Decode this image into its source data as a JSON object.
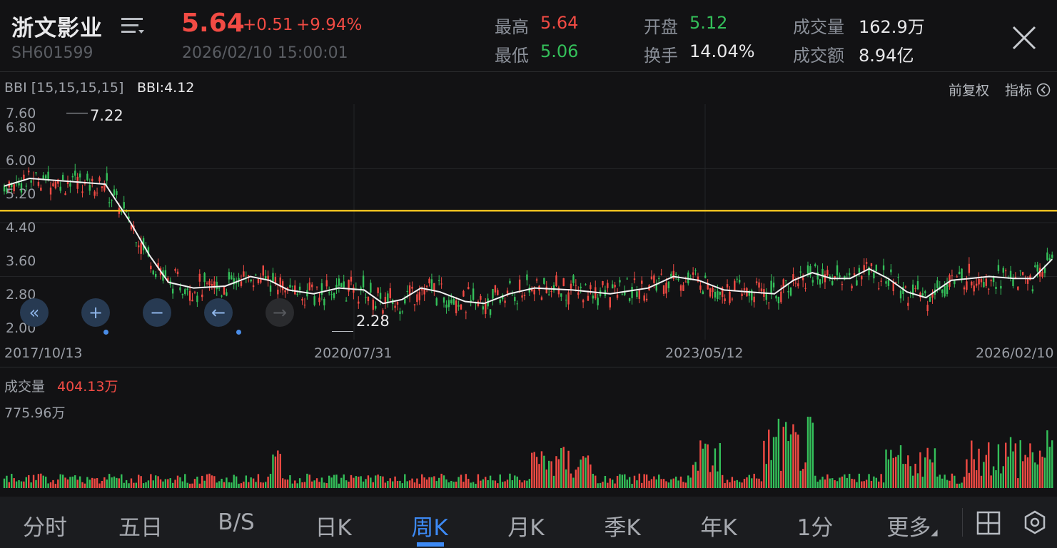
{
  "header": {
    "stock_name": "浙文影业",
    "stock_code": "SH601599",
    "price": "5.64",
    "change": "+0.51",
    "change_pct": "+9.94%",
    "datetime": "2026/02/10 15:00:01",
    "stats": {
      "high_label": "最高",
      "high": "5.64",
      "low_label": "最低",
      "low": "5.06",
      "open_label": "开盘",
      "open": "5.12",
      "turnover_label": "换手",
      "turnover": "14.04%",
      "volume_label": "成交量",
      "volume": "162.9万",
      "amount_label": "成交额",
      "amount": "8.94亿"
    }
  },
  "indicator_bar": {
    "name": "BBI [15,15,15,15]",
    "value": "BBI:4.12",
    "adjust": "前复权",
    "indicator": "指标"
  },
  "chart_data": {
    "type": "candlestick",
    "y_ticks": [
      "7.60",
      "6.80",
      "6.00",
      "5.20",
      "4.40",
      "3.60",
      "2.80",
      "2.00"
    ],
    "ylim": [
      2.0,
      7.6
    ],
    "x_ticks": [
      "2017/10/13",
      "2020/07/31",
      "2023/05/12",
      "2026/02/10"
    ],
    "max_label": "7.22",
    "min_label": "2.28",
    "reference_line": 5.11,
    "bbi_points": [
      [
        2017.8,
        5.75
      ],
      [
        2018.0,
        5.95
      ],
      [
        2018.4,
        5.85
      ],
      [
        2018.6,
        5.8
      ],
      [
        2018.8,
        4.8
      ],
      [
        2018.95,
        3.95
      ],
      [
        2019.1,
        3.25
      ],
      [
        2019.3,
        3.1
      ],
      [
        2019.55,
        3.15
      ],
      [
        2019.75,
        3.4
      ],
      [
        2019.9,
        3.3
      ],
      [
        2020.05,
        3.05
      ],
      [
        2020.25,
        2.95
      ],
      [
        2020.45,
        3.1
      ],
      [
        2020.65,
        3.05
      ],
      [
        2020.8,
        2.7
      ],
      [
        2020.95,
        2.8
      ],
      [
        2021.1,
        3.1
      ],
      [
        2021.25,
        3.0
      ],
      [
        2021.45,
        2.75
      ],
      [
        2021.6,
        2.7
      ],
      [
        2021.8,
        2.95
      ],
      [
        2022.0,
        3.1
      ],
      [
        2022.3,
        3.05
      ],
      [
        2022.6,
        2.95
      ],
      [
        2022.9,
        3.1
      ],
      [
        2023.1,
        3.4
      ],
      [
        2023.3,
        3.3
      ],
      [
        2023.5,
        3.05
      ],
      [
        2023.7,
        3.0
      ],
      [
        2023.9,
        2.95
      ],
      [
        2024.05,
        3.3
      ],
      [
        2024.2,
        3.5
      ],
      [
        2024.35,
        3.35
      ],
      [
        2024.5,
        3.35
      ],
      [
        2024.65,
        3.6
      ],
      [
        2024.8,
        3.35
      ],
      [
        2024.95,
        3.0
      ],
      [
        2025.1,
        2.85
      ],
      [
        2025.3,
        3.3
      ],
      [
        2025.45,
        3.35
      ],
      [
        2025.6,
        3.4
      ],
      [
        2025.8,
        3.35
      ],
      [
        2025.95,
        3.35
      ],
      [
        2026.1,
        3.85
      ]
    ],
    "volume": {
      "label": "成交量",
      "value": "404.13万",
      "max": "775.96万"
    }
  },
  "nav_buttons": [
    "«",
    "+",
    "−",
    "←",
    "→"
  ],
  "tabs": [
    "分时",
    "五日",
    "B/S",
    "日K",
    "周K",
    "月K",
    "季K",
    "年K",
    "1分",
    "更多"
  ],
  "active_tab": "周K",
  "colors": {
    "up": "#f24b44",
    "down": "#34c05a",
    "accent": "#3d8af5",
    "ref_line": "#f0c020"
  }
}
